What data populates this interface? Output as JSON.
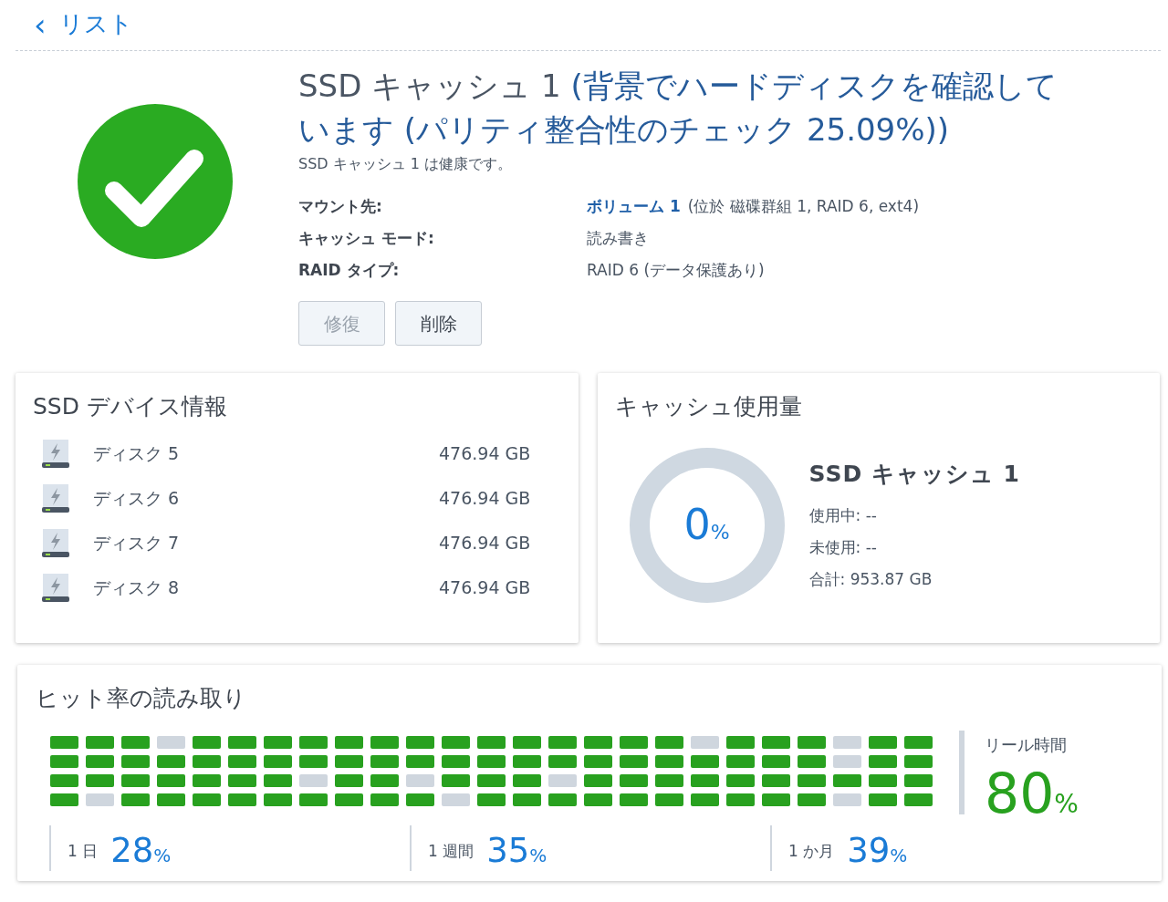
{
  "back_link": {
    "icon": "‹",
    "label": "リスト"
  },
  "header": {
    "name": "SSD キャッシュ 1",
    "status": "(背景でハードディスクを確認しています (パリティ整合性のチェック 25.09%))",
    "health": "SSD キャッシュ 1 は健康です。",
    "healthy": true
  },
  "details": [
    {
      "label": "マウント先:",
      "link": "ボリューム 1",
      "value": "(位於 磁碟群組 1, RAID 6, ext4)"
    },
    {
      "label": "キャッシュ モード:",
      "value": "読み書き"
    },
    {
      "label": "RAID タイプ:",
      "value": "RAID 6 (データ保護あり)"
    }
  ],
  "buttons": [
    {
      "label": "修復",
      "disabled": true
    },
    {
      "label": "削除",
      "disabled": false
    }
  ],
  "devices": {
    "title": "SSD デバイス情報",
    "items": [
      {
        "name": "ディスク 5",
        "size": "476.94 GB"
      },
      {
        "name": "ディスク 6",
        "size": "476.94 GB"
      },
      {
        "name": "ディスク 7",
        "size": "476.94 GB"
      },
      {
        "name": "ディスク 8",
        "size": "476.94 GB"
      }
    ]
  },
  "usage": {
    "title": "キャッシュ使用量",
    "percent": "0",
    "unit": "%",
    "name": "SSD キャッシュ 1",
    "lines": [
      "使用中: --",
      "未使用: --",
      "合計: 953.87 GB"
    ]
  },
  "hit_rate": {
    "title": "ヒット率の読み取り",
    "rows": [
      [
        true,
        true,
        true,
        false,
        true,
        true,
        true,
        true,
        true,
        true,
        true,
        true,
        true,
        true,
        true,
        true,
        true,
        true,
        false,
        true,
        true,
        true,
        false,
        true,
        true
      ],
      [
        true,
        true,
        true,
        true,
        true,
        true,
        true,
        true,
        true,
        true,
        true,
        true,
        true,
        true,
        true,
        true,
        true,
        true,
        true,
        true,
        true,
        true,
        false,
        true,
        true
      ],
      [
        true,
        true,
        true,
        true,
        true,
        true,
        true,
        false,
        true,
        true,
        false,
        true,
        true,
        true,
        false,
        true,
        true,
        true,
        true,
        true,
        true,
        true,
        true,
        true,
        true
      ],
      [
        true,
        false,
        true,
        true,
        true,
        true,
        true,
        true,
        true,
        true,
        true,
        false,
        true,
        true,
        true,
        true,
        true,
        true,
        true,
        true,
        true,
        true,
        false,
        true,
        true
      ]
    ],
    "realtime": {
      "label": "リール時間",
      "value": "80",
      "unit": "%"
    },
    "stats": [
      {
        "label": "1 日",
        "value": "28",
        "unit": "%"
      },
      {
        "label": "1 週間",
        "value": "35",
        "unit": "%"
      },
      {
        "label": "1 か月",
        "value": "39",
        "unit": "%"
      }
    ]
  }
}
